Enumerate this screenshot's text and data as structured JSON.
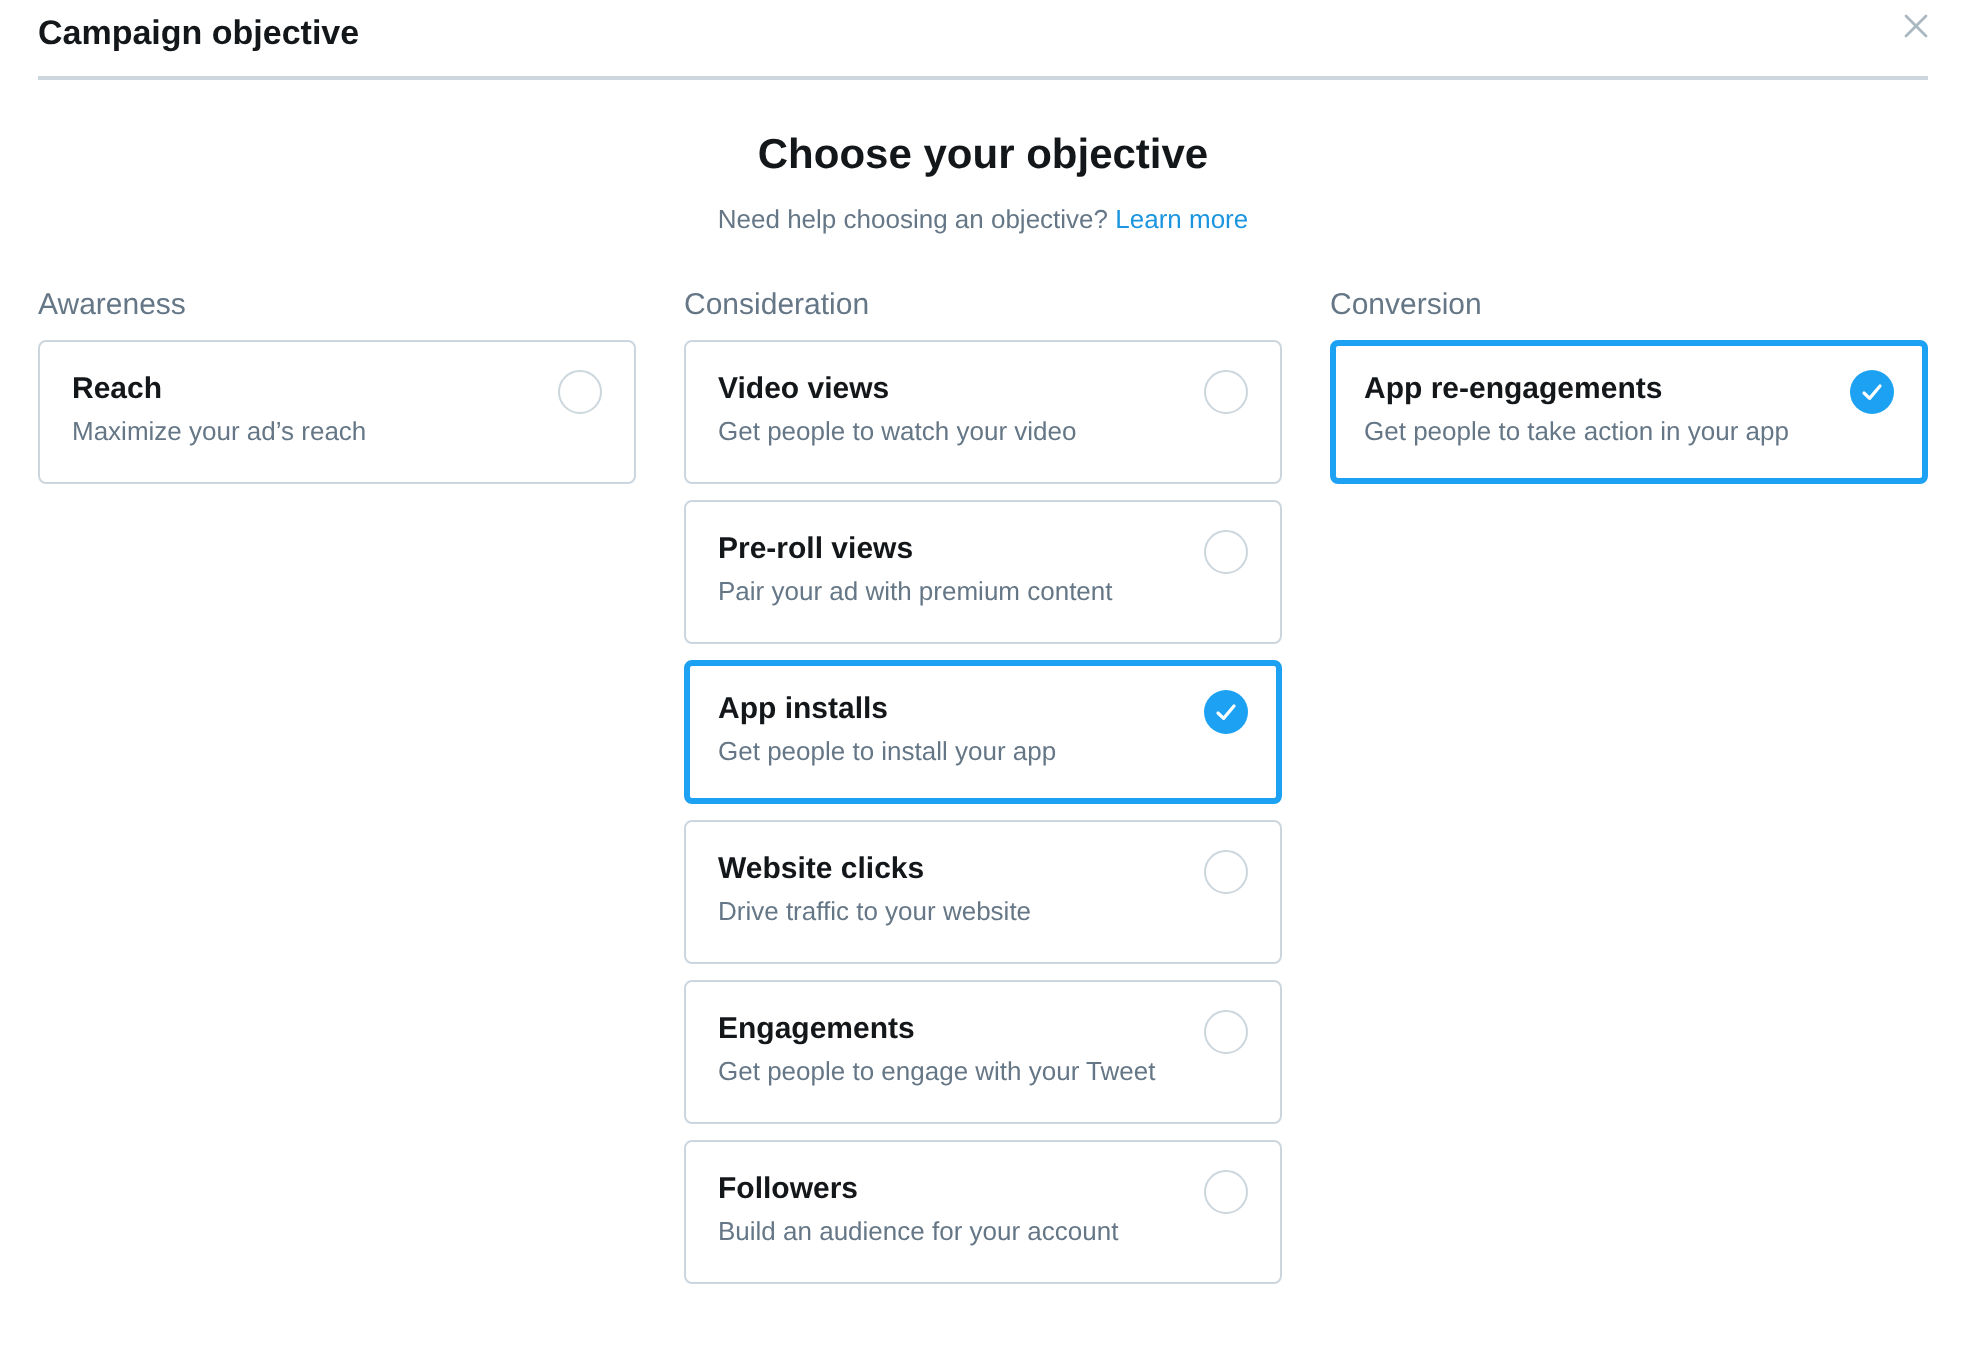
{
  "window": {
    "title": "Campaign objective"
  },
  "heading": "Choose your objective",
  "help": {
    "text": "Need help choosing an objective?",
    "link": "Learn more"
  },
  "groups": [
    {
      "label": "Awareness",
      "options": [
        {
          "title": "Reach",
          "description": "Maximize your ad’s reach",
          "selected": false
        }
      ]
    },
    {
      "label": "Consideration",
      "options": [
        {
          "title": "Video views",
          "description": "Get people to watch your video",
          "selected": false
        },
        {
          "title": "Pre-roll views",
          "description": "Pair your ad with premium content",
          "selected": false
        },
        {
          "title": "App installs",
          "description": "Get people to install your app",
          "selected": true
        },
        {
          "title": "Website clicks",
          "description": "Drive traffic to your website",
          "selected": false
        },
        {
          "title": "Engagements",
          "description": "Get people to engage with your Tweet",
          "selected": false
        },
        {
          "title": "Followers",
          "description": "Build an audience for your account",
          "selected": false
        }
      ]
    },
    {
      "label": "Conversion",
      "options": [
        {
          "title": "App re-engagements",
          "description": "Get people to take action in your app",
          "selected": true
        }
      ]
    }
  ]
}
